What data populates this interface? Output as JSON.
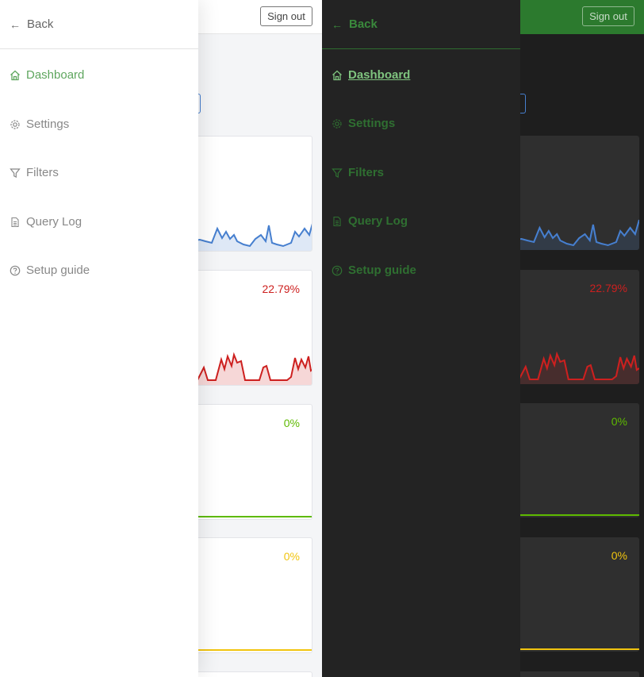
{
  "header": {
    "sign_out_label": "Sign out"
  },
  "drawer": {
    "back_label": "Back",
    "items": [
      {
        "label": "Dashboard",
        "icon": "home-icon",
        "active": true
      },
      {
        "label": "Settings",
        "icon": "gear-icon"
      },
      {
        "label": "Filters",
        "icon": "filter-icon"
      },
      {
        "label": "Query Log",
        "icon": "document-icon"
      },
      {
        "label": "Setup guide",
        "icon": "help-circle-icon"
      }
    ]
  },
  "cards": [
    {
      "percent": "",
      "color": "#467fcf"
    },
    {
      "percent": "22.79%",
      "color": "#cd201f"
    },
    {
      "percent": "0%",
      "color": "#5eba00"
    },
    {
      "percent": "0%",
      "color": "#f1c40f"
    }
  ],
  "colors": {
    "light_accent": "#5ea65e",
    "dark_header": "#2c7a2e",
    "dark_accent": "#3a8a3c"
  }
}
